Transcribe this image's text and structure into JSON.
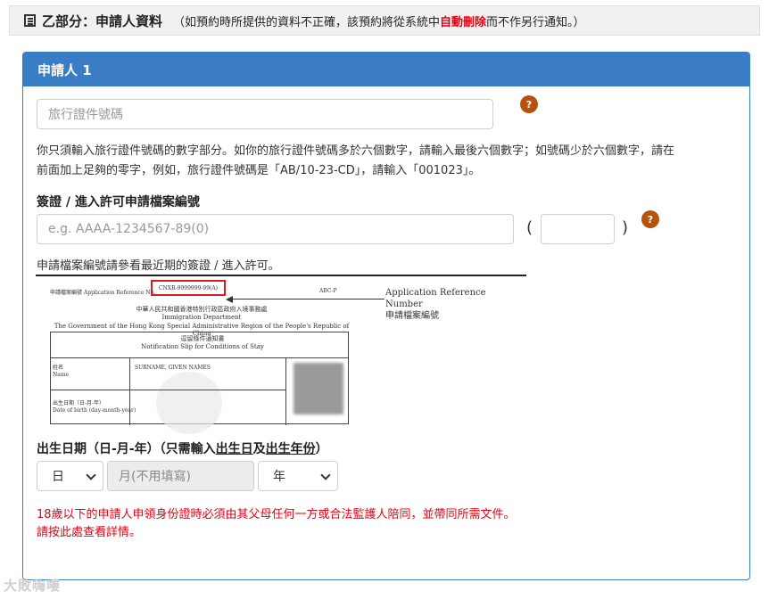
{
  "section": {
    "title": "乙部分：申請人資料",
    "note_pre": "（如預約時所提供的資料不正確，該預約將從系統中",
    "note_red": "自動刪除",
    "note_post": "而不作另行通知。）"
  },
  "panel": {
    "title": "申請人 1"
  },
  "travel_doc": {
    "placeholder": "旅行證件號碼",
    "help_line1": "你只須輸入旅行證件號碼的數字部分。如你的旅行證件號碼多於六個數字，請輸入最後六個數字；如號碼少於六個數字，請在",
    "help_line2": "前面加上足夠的零字，例如，旅行證件號碼是「AB/10-23-CD」，請輸入「001023」。"
  },
  "visa": {
    "label": "簽證 / 進入許可申請檔案編號",
    "placeholder": "e.g. AAAA-1234567-89(0)",
    "paren_open": "(",
    "paren_close": ")",
    "note": "申請檔案編號請參看最近期的簽證 / 進入許可。"
  },
  "sample_slip": {
    "ref_label": "申請檔案編號 Application Reference No.",
    "ref_value": "CNXR-9999999-99(A)",
    "abc": "ABC-P",
    "line1": "中華人民共和國香港特別行政區政府入境事務處",
    "line2": "Immigration Department",
    "line3": "The Government of the Hong Kong Special Administrative Region of the People's Republic of China",
    "line4": "逗留條件通知書",
    "line5": "Notification Slip for Conditions of Stay",
    "name_zh": "姓名",
    "name_en": "Name",
    "name_value": "SURNAME, GIVEN NAMES",
    "dob_zh": "出生日期（日-月-年）",
    "dob_en": "Date of birth (day-month-year)",
    "app_ref_en": "Application Reference Number",
    "app_ref_zh": "申請檔案編號"
  },
  "dob": {
    "label_pre": "出生日期（日-月-年）（只需輸入",
    "label_u1": "出生日",
    "label_mid": "及",
    "label_u2": "出生年份",
    "label_post": "）",
    "day": "日",
    "month_placeholder": "月(不用填寫)",
    "year": "年"
  },
  "guardian": {
    "line1": "18歲以下的申請人申領身份證時必須由其父母任何一方或合法監護人陪同，並帶同所需文件。",
    "line2_pre": "請按",
    "line2_link": "此處",
    "line2_post": "查看詳情。"
  },
  "watermark": "大敗嗨嘍"
}
